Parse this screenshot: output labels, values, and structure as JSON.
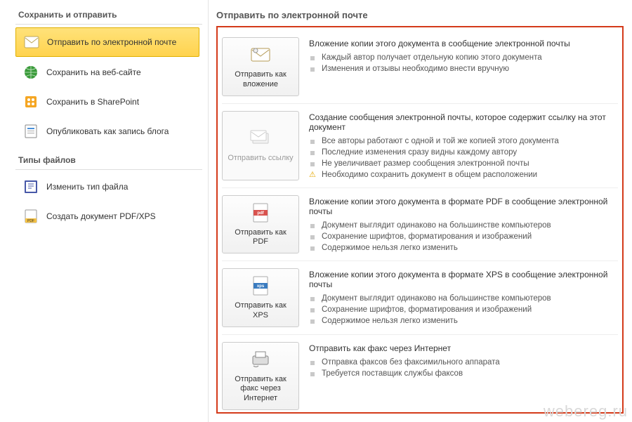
{
  "sidebar": {
    "heading1": "Сохранить и отправить",
    "heading2": "Типы файлов",
    "items1": [
      {
        "label": "Отправить по электронной почте",
        "selected": true
      },
      {
        "label": "Сохранить на веб-сайте"
      },
      {
        "label": "Сохранить в SharePoint"
      },
      {
        "label": "Опубликовать как запись блога"
      }
    ],
    "items2": [
      {
        "label": "Изменить тип файла"
      },
      {
        "label": "Создать документ PDF/XPS"
      }
    ]
  },
  "main": {
    "title": "Отправить по электронной почте",
    "options": [
      {
        "button": "Отправить как вложение",
        "disabled": false,
        "headline": "Вложение копии этого документа в сообщение электронной почты",
        "bullets": [
          "Каждый автор получает отдельную копию этого документа",
          "Изменения и отзывы необходимо внести вручную"
        ]
      },
      {
        "button": "Отправить ссылку",
        "disabled": true,
        "headline": "Создание сообщения электронной почты, которое содержит ссылку на этот документ",
        "bullets": [
          "Все авторы работают с одной и той же копией этого документа",
          "Последние изменения сразу видны каждому автору",
          "Не увеличивает размер сообщения электронной почты"
        ],
        "warn": "Необходимо сохранить документ в общем расположении"
      },
      {
        "button": "Отправить как PDF",
        "disabled": false,
        "headline": "Вложение копии этого документа в формате PDF в сообщение электронной почты",
        "bullets": [
          "Документ выглядит одинаково на большинстве компьютеров",
          "Сохранение шрифтов, форматирования и изображений",
          "Содержимое нельзя легко изменить"
        ]
      },
      {
        "button": "Отправить как XPS",
        "disabled": false,
        "headline": "Вложение копии этого документа в формате XPS в сообщение электронной почты",
        "bullets": [
          "Документ выглядит одинаково на большинстве компьютеров",
          "Сохранение шрифтов, форматирования и изображений",
          "Содержимое нельзя легко изменить"
        ]
      },
      {
        "button": "Отправить как факс через Интернет",
        "disabled": false,
        "headline": "Отправить как факс через Интернет",
        "bullets": [
          "Отправка факсов без факсимильного аппарата",
          "Требуется поставщик службы факсов"
        ]
      }
    ]
  },
  "watermark": "webereg.ru"
}
